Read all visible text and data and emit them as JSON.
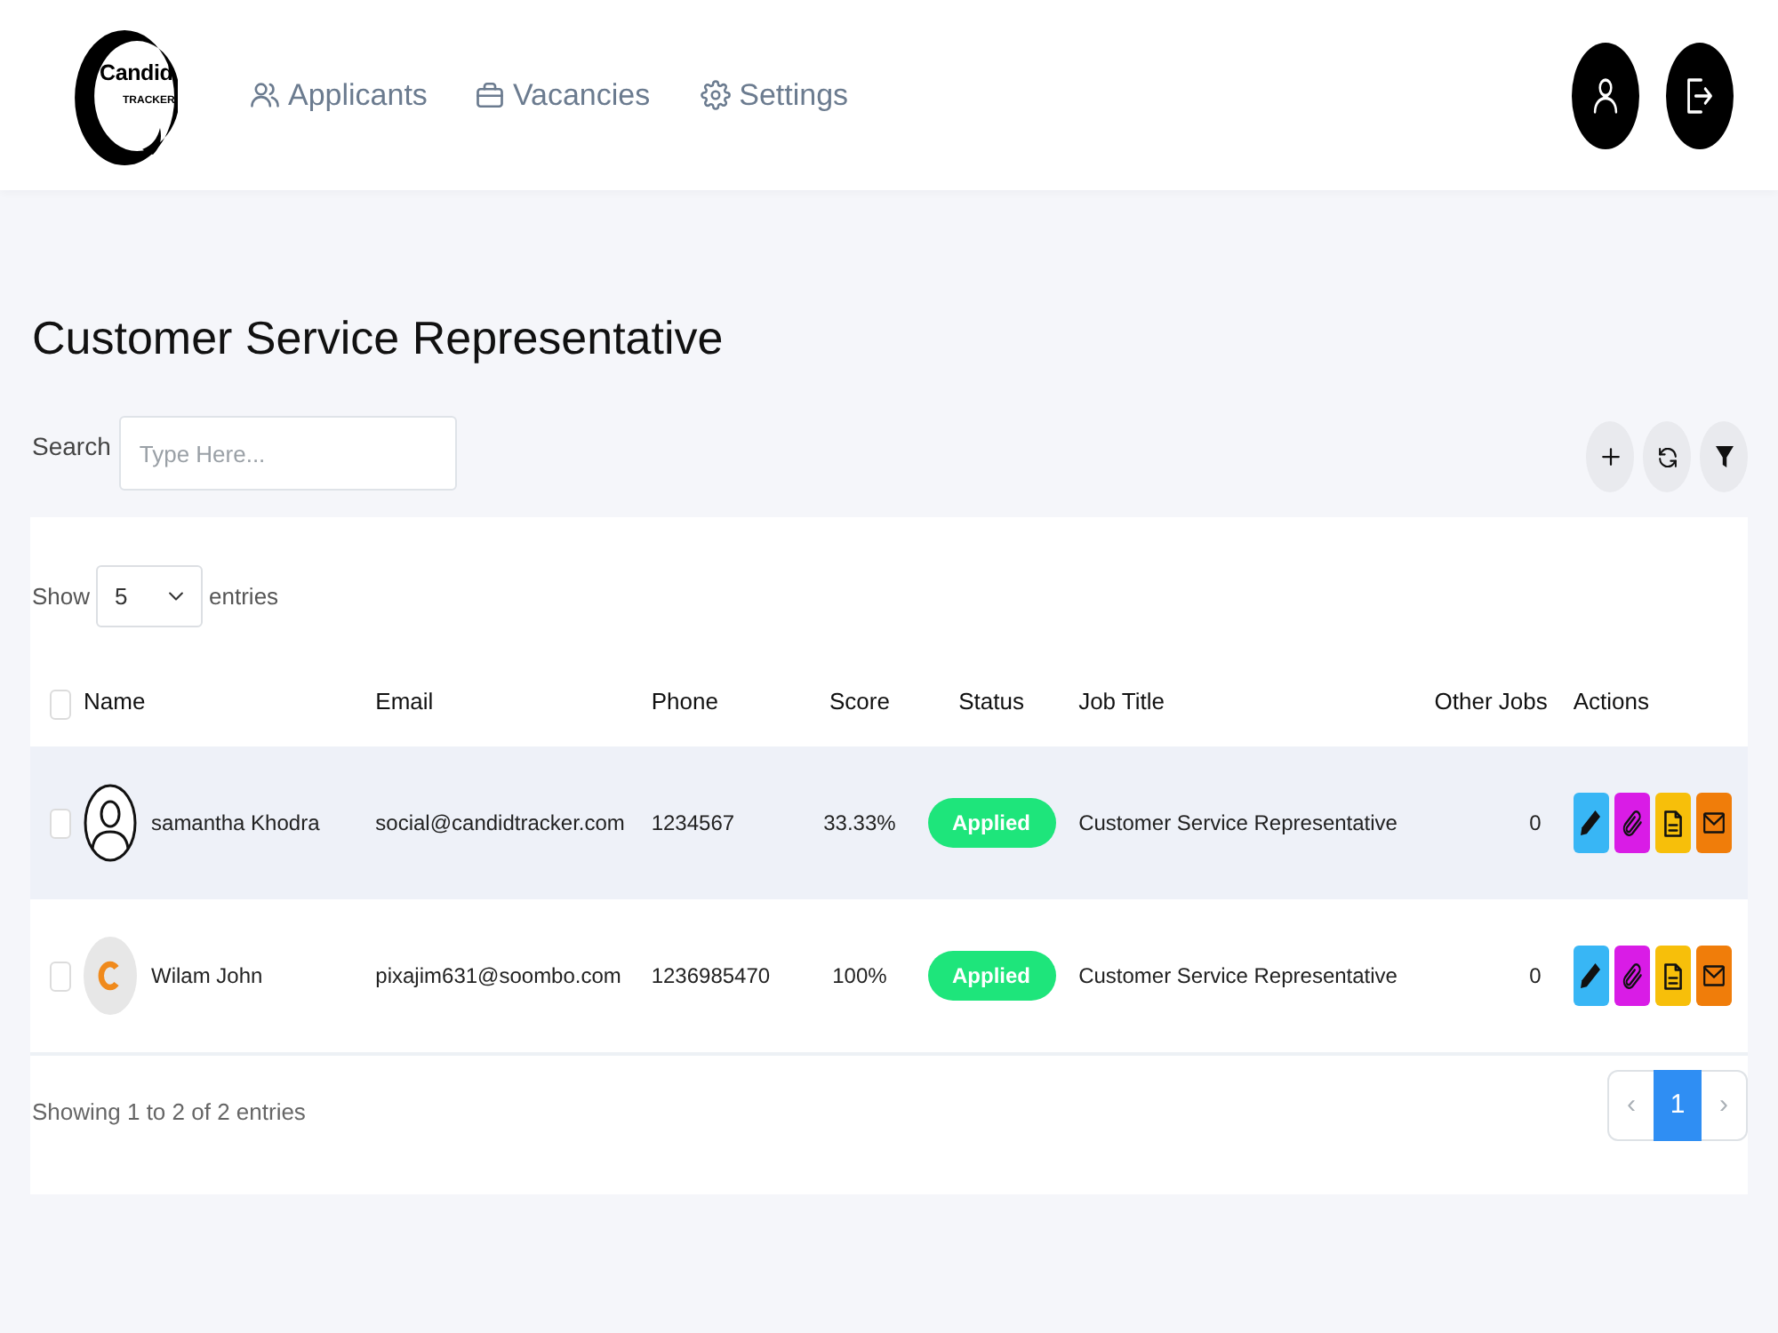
{
  "brand": {
    "name": "Candid",
    "tagline": "TRACKER"
  },
  "nav": [
    {
      "kind": "applicants",
      "label": "Applicants"
    },
    {
      "kind": "vacancies",
      "label": "Vacancies"
    },
    {
      "kind": "settings",
      "label": "Settings"
    }
  ],
  "account_buttons": [
    {
      "kind": "profile"
    },
    {
      "kind": "logout"
    }
  ],
  "page": {
    "title": "Customer Service Representative"
  },
  "search": {
    "label": "Search",
    "placeholder": "Type Here..."
  },
  "toolbar": [
    {
      "kind": "add"
    },
    {
      "kind": "refresh"
    },
    {
      "kind": "filter"
    }
  ],
  "length_menu": {
    "prefix": "Show",
    "value": "5",
    "suffix": "entries"
  },
  "table": {
    "select_all": {
      "checked": false
    },
    "columns": [
      "Name",
      "Email",
      "Phone",
      "Score",
      "Status",
      "Job Title",
      "Other Jobs",
      "Actions"
    ],
    "rows": [
      {
        "checked": false,
        "highlighted": true,
        "avatar": {
          "kind": "default"
        },
        "name": "samantha Khodra",
        "email": "social@candidtracker.com",
        "phone": "1234567",
        "score": "33.33%",
        "status": "Applied",
        "job_title": "Customer Service Representative",
        "other_jobs": "0",
        "actions": [
          {
            "kind": "edit",
            "color": "#38b6f5"
          },
          {
            "kind": "attach",
            "color": "#d91ce6"
          },
          {
            "kind": "document",
            "color": "#f7bf0a"
          },
          {
            "kind": "mail",
            "color": "#f07d0a"
          }
        ]
      },
      {
        "checked": false,
        "highlighted": false,
        "avatar": {
          "kind": "image"
        },
        "name": "Wilam John",
        "email": "pixajim631@soombo.com",
        "phone": "1236985470",
        "score": "100%",
        "status": "Applied",
        "job_title": "Customer Service Representative",
        "other_jobs": "0",
        "actions": [
          {
            "kind": "edit",
            "color": "#38b6f5"
          },
          {
            "kind": "attach",
            "color": "#d91ce6"
          },
          {
            "kind": "document",
            "color": "#f7bf0a"
          },
          {
            "kind": "mail",
            "color": "#f07d0a"
          }
        ]
      }
    ]
  },
  "footer": {
    "info": "Showing 1 to 2 of 2 entries",
    "pagination": {
      "previous": {
        "label": "‹",
        "disabled": true
      },
      "pages": [
        {
          "label": "1",
          "selected": true
        }
      ],
      "next": {
        "label": "›",
        "disabled": true
      }
    }
  }
}
